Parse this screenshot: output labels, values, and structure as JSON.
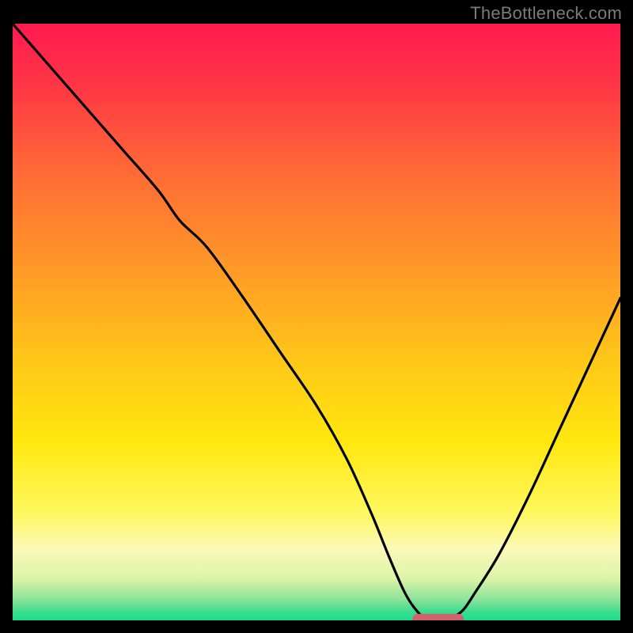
{
  "watermark": "TheBottleneck.com",
  "chart_data": {
    "type": "line",
    "title": "",
    "xlabel": "",
    "ylabel": "",
    "xlim": [
      0,
      100
    ],
    "ylim": [
      0,
      100
    ],
    "grid": false,
    "background_gradient": {
      "stops": [
        {
          "offset": 0.0,
          "color": "#ff1a4f"
        },
        {
          "offset": 0.1,
          "color": "#ff3546"
        },
        {
          "offset": 0.25,
          "color": "#ff6a36"
        },
        {
          "offset": 0.4,
          "color": "#ff9628"
        },
        {
          "offset": 0.55,
          "color": "#ffc31a"
        },
        {
          "offset": 0.7,
          "color": "#ffe70e"
        },
        {
          "offset": 0.82,
          "color": "#fff85f"
        },
        {
          "offset": 0.88,
          "color": "#fcf9b9"
        },
        {
          "offset": 0.93,
          "color": "#dcf4a8"
        },
        {
          "offset": 0.965,
          "color": "#8be39a"
        },
        {
          "offset": 0.985,
          "color": "#3edc8f"
        },
        {
          "offset": 1.0,
          "color": "#18e08c"
        }
      ]
    },
    "series": [
      {
        "name": "bottleneck-curve",
        "x": [
          0,
          6,
          12,
          18,
          24,
          27.5,
          32,
          38,
          44,
          50,
          55,
          59,
          62,
          64.5,
          66.5,
          68,
          72,
          74,
          76,
          80,
          85,
          90,
          95,
          100
        ],
        "y": [
          100,
          93,
          86,
          79,
          72,
          67,
          62.5,
          54,
          45,
          36,
          27,
          18,
          10.5,
          4.7,
          1.6,
          0.6,
          0.6,
          1.6,
          4.5,
          11,
          21,
          32,
          43,
          54
        ]
      }
    ],
    "marker": {
      "name": "optimal-range",
      "shape": "capsule",
      "color": "#d1626d",
      "x_center": 70,
      "x_halfwidth": 4.2,
      "y": 0.25,
      "height": 1.7
    }
  }
}
